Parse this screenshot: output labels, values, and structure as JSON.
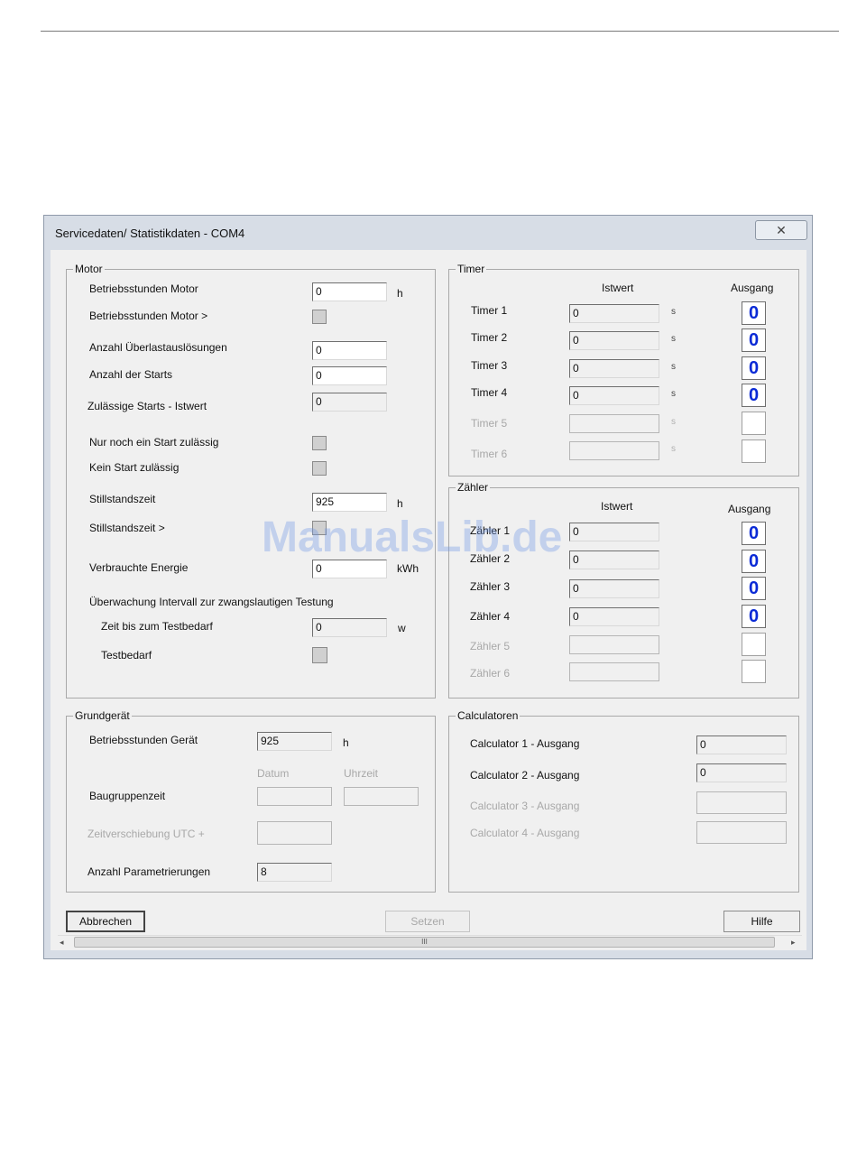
{
  "window": {
    "title": "Servicedaten/ Statistikdaten - COM4",
    "close_glyph": "✕"
  },
  "motor": {
    "title": "Motor",
    "betriebsstunden_label": "Betriebsstunden Motor",
    "betriebsstunden_value": "0",
    "betriebsstunden_unit": "h",
    "betriebsstunden_gt_label": "Betriebsstunden Motor >",
    "ueberlast_label": "Anzahl Überlastauslösungen",
    "ueberlast_value": "0",
    "starts_label": "Anzahl der Starts",
    "starts_value": "0",
    "zul_starts_label": "Zulässige Starts - Istwert",
    "zul_starts_value": "0",
    "nur_noch_label": "Nur noch ein Start zulässig",
    "kein_start_label": "Kein Start zulässig",
    "stillstand_label": "Stillstandszeit",
    "stillstand_value": "925",
    "stillstand_unit": "h",
    "stillstand_gt_label": "Stillstandszeit >",
    "energie_label": "Verbrauchte Energie",
    "energie_value": "0",
    "energie_unit": "kWh",
    "ueberwachung_label": "Überwachung Intervall zur zwangslautigen Testung",
    "zeit_test_label": "Zeit bis zum Testbedarf",
    "zeit_test_value": "0",
    "zeit_test_unit": "w",
    "testbedarf_label": "Testbedarf"
  },
  "timer": {
    "title": "Timer",
    "istwert_header": "Istwert",
    "ausgang_header": "Ausgang",
    "rows": [
      {
        "label": "Timer 1",
        "value": "0",
        "unit": "s",
        "out": "0"
      },
      {
        "label": "Timer 2",
        "value": "0",
        "unit": "s",
        "out": "0"
      },
      {
        "label": "Timer 3",
        "value": "0",
        "unit": "s",
        "out": "0"
      },
      {
        "label": "Timer 4",
        "value": "0",
        "unit": "s",
        "out": "0"
      },
      {
        "label": "Timer 5",
        "value": "",
        "unit": "s",
        "out": ""
      },
      {
        "label": "Timer 6",
        "value": "",
        "unit": "s",
        "out": ""
      }
    ]
  },
  "zaehler": {
    "title": "Zähler",
    "istwert_header": "Istwert",
    "ausgang_header": "Ausgang",
    "rows": [
      {
        "label": "Zähler 1",
        "value": "0",
        "out": "0"
      },
      {
        "label": "Zähler 2",
        "value": "0",
        "out": "0"
      },
      {
        "label": "Zähler 3",
        "value": "0",
        "out": "0"
      },
      {
        "label": "Zähler 4",
        "value": "0",
        "out": "0"
      },
      {
        "label": "Zähler 5",
        "value": "",
        "out": ""
      },
      {
        "label": "Zähler 6",
        "value": "",
        "out": ""
      }
    ]
  },
  "grundgeraet": {
    "title": "Grundgerät",
    "betriebsstunden_label": "Betriebsstunden Gerät",
    "betriebsstunden_value": "925",
    "betriebsstunden_unit": "h",
    "datum_header": "Datum",
    "uhrzeit_header": "Uhrzeit",
    "baugruppenzeit_label": "Baugruppenzeit",
    "zeitverschiebung_label": "Zeitverschiebung UTC +",
    "parametrierungen_label": "Anzahl Parametrierungen",
    "parametrierungen_value": "8"
  },
  "calculatoren": {
    "title": "Calculatoren",
    "rows": [
      {
        "label": "Calculator 1 - Ausgang",
        "value": "0"
      },
      {
        "label": "Calculator 2 - Ausgang",
        "value": "0"
      },
      {
        "label": "Calculator 3 - Ausgang",
        "value": ""
      },
      {
        "label": "Calculator 4 - Ausgang",
        "value": ""
      }
    ]
  },
  "buttons": {
    "abbrechen": "Abbrechen",
    "setzen": "Setzen",
    "hilfe": "Hilfe"
  },
  "scrollbar": {
    "left_arrow": "◂",
    "right_arrow": "▸",
    "grip": "III"
  },
  "watermark": "ManualsLib.de",
  "colors": {
    "output_digit": "#0a2ad6",
    "disabled_text": "#a8a8a8",
    "window_frame": "#d7dde6"
  }
}
